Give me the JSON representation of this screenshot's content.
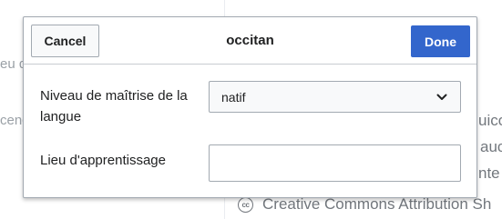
{
  "background": {
    "left_fragments": [
      "eu d",
      "cenc"
    ],
    "right_fragments": [
      "uico",
      "auc",
      "nte"
    ],
    "footer_icon": "creative-commons-icon",
    "footer_icon_glyph": "cc",
    "footer_text": "Creative Commons Attribution Sh"
  },
  "dialog": {
    "title": "occitan",
    "cancel_label": "Cancel",
    "done_label": "Done",
    "primary_color": "#3366cc",
    "fields": {
      "proficiency": {
        "label": "Niveau de maîtrise de la langue",
        "value": "natif",
        "icon": "chevron-down-icon"
      },
      "place": {
        "label": "Lieu d'apprentissage",
        "value": "",
        "placeholder": ""
      }
    }
  }
}
